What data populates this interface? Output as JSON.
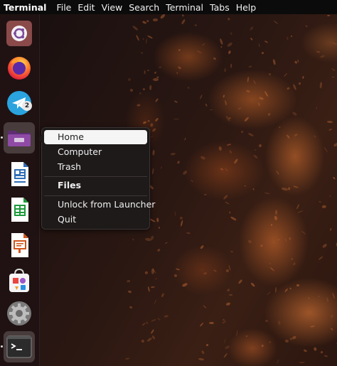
{
  "topbar": {
    "app_name": "Terminal",
    "menus": [
      "File",
      "Edit",
      "View",
      "Search",
      "Terminal",
      "Tabs",
      "Help"
    ]
  },
  "dock": {
    "telegram_badge": "2",
    "items": [
      "ubuntu-software",
      "firefox",
      "telegram",
      "files",
      "libreoffice-writer",
      "libreoffice-calc",
      "libreoffice-impress",
      "app-center",
      "settings",
      "terminal"
    ]
  },
  "context_menu": {
    "items": {
      "home": "Home",
      "computer": "Computer",
      "trash": "Trash",
      "files": "Files",
      "unlock": "Unlock from Launcher",
      "quit": "Quit"
    }
  },
  "colors": {
    "dock_bg": "#22141480",
    "menu_bg": "#1e1a1a",
    "files_icon": "#7b3f8f",
    "firefox": "#ff7139",
    "telegram": "#2aa3df"
  }
}
